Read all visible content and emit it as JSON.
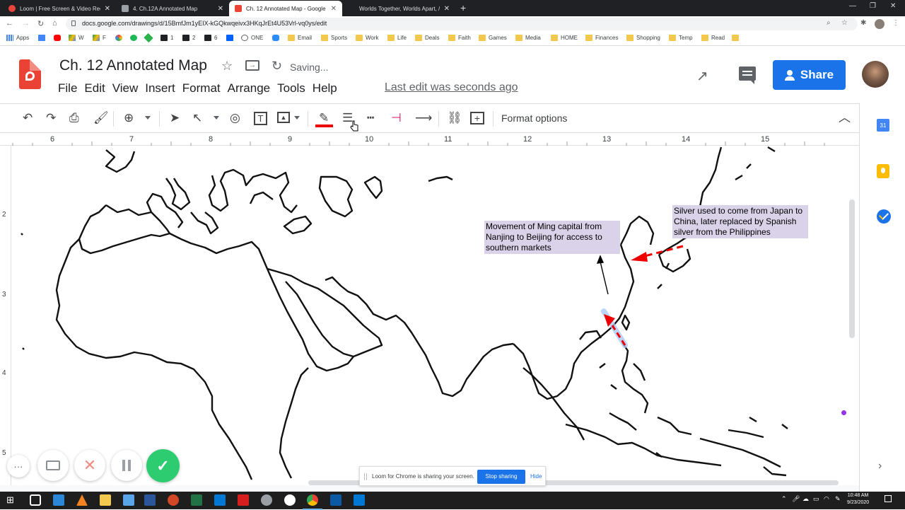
{
  "browser": {
    "tabs": [
      {
        "title": "Loom | Free Screen & Video Rec",
        "favicon_color": "#e8453c",
        "active": false
      },
      {
        "title": "4. Ch.12A Annotated Map",
        "favicon_color": "#9aa0a6",
        "active": false
      },
      {
        "title": "Ch. 12 Annotated Map - Google",
        "favicon_color": "#ea4335",
        "active": true
      },
      {
        "title": "Worlds Together, Worlds Apart, /",
        "favicon_color": "#5f6368",
        "active": false
      }
    ],
    "url": "docs.google.com/drawings/d/15BmfJm1yEIX-kGQkwqeivx3HKqJrEt4U53Vrl-vq0ys/edit",
    "bookmarks": [
      {
        "label": "Apps",
        "type": "apps"
      },
      {
        "label": "",
        "type": "calendar"
      },
      {
        "label": "",
        "type": "youtube"
      },
      {
        "label": "W",
        "type": "drive"
      },
      {
        "label": "F",
        "type": "drive2"
      },
      {
        "label": "",
        "type": "photos"
      },
      {
        "label": "",
        "type": "spotify"
      },
      {
        "label": "",
        "type": "feedly"
      },
      {
        "label": "1",
        "type": "dark"
      },
      {
        "label": "2",
        "type": "dark"
      },
      {
        "label": "6",
        "type": "dark"
      },
      {
        "label": "",
        "type": "dropbox"
      },
      {
        "label": "ONE",
        "type": "one"
      },
      {
        "label": "",
        "type": "zoom"
      },
      {
        "label": "Email",
        "type": "folder"
      },
      {
        "label": "Sports",
        "type": "folder"
      },
      {
        "label": "Work",
        "type": "folder"
      },
      {
        "label": "Life",
        "type": "folder"
      },
      {
        "label": "Deals",
        "type": "folder"
      },
      {
        "label": "Faith",
        "type": "folder"
      },
      {
        "label": "Games",
        "type": "folder"
      },
      {
        "label": "Media",
        "type": "folder"
      },
      {
        "label": "HOME",
        "type": "folder"
      },
      {
        "label": "Finances",
        "type": "folder"
      },
      {
        "label": "Shopping",
        "type": "folder"
      },
      {
        "label": "Temp",
        "type": "folder"
      },
      {
        "label": "Read",
        "type": "folder"
      }
    ]
  },
  "doc": {
    "title": "Ch. 12 Annotated Map",
    "status": "Saving...",
    "menu": [
      "File",
      "Edit",
      "View",
      "Insert",
      "Format",
      "Arrange",
      "Tools",
      "Help"
    ],
    "last_edit": "Last edit was seconds ago",
    "share_label": "Share",
    "format_options": "Format options"
  },
  "ruler": {
    "horizontal": [
      "6",
      "7",
      "8",
      "9",
      "10",
      "11",
      "12",
      "13",
      "14",
      "15"
    ],
    "vertical": [
      "2",
      "3",
      "4",
      "5"
    ]
  },
  "annotations": {
    "ming": "Movement of Ming capital from Nanjing to Beijing for access to southern markets",
    "silver": "Silver used to come from Japan to China, later replaced by Spanish silver from the Philippines"
  },
  "loom": {
    "sharing_text": "Loom for Chrome is sharing your screen.",
    "stop_label": "Stop sharing",
    "hide_label": "Hide"
  },
  "taskbar": {
    "time": "10:48 AM",
    "date": "9/23/2020"
  },
  "colors": {
    "accent": "#1a73e8",
    "drawings_red": "#ea4335",
    "annotation_bg": "#d9d2e9",
    "arrow_red": "#ee0000"
  }
}
